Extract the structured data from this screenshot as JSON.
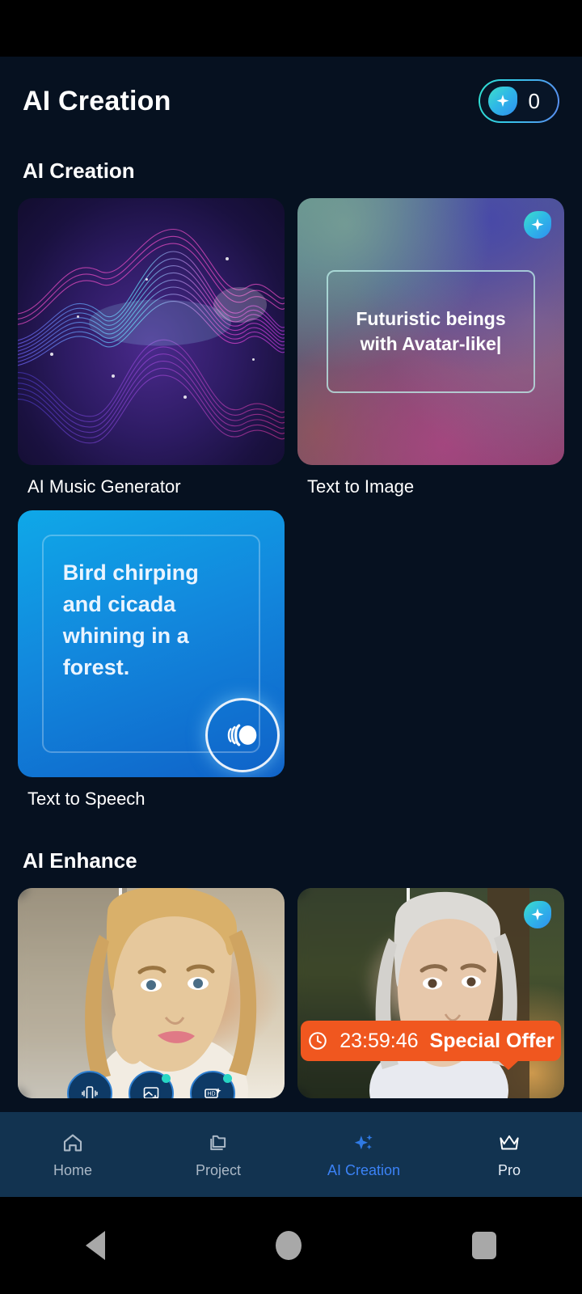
{
  "header": {
    "title": "AI Creation",
    "credits_value": "0",
    "credits_icon": "sparkle-droplet-icon"
  },
  "sections": [
    {
      "title": "AI Creation"
    },
    {
      "title": "AI Enhance"
    }
  ],
  "creation_cards": [
    {
      "label": "AI Music Generator",
      "art": "sound-wave-art"
    },
    {
      "label": "Text to Image",
      "prompt": "Futuristic beings with Avatar-like|",
      "badge": "sparkle-droplet-icon"
    },
    {
      "label": "Text to Speech",
      "prompt": "Bird chirping and cicada whining in a forest.",
      "icon": "speaker-icon"
    }
  ],
  "enhance_cards": [
    {
      "art": "portrait-before-after-indoor",
      "actions": [
        {
          "icon": "stabilize-icon",
          "has_badge": false
        },
        {
          "icon": "image-enhance-icon",
          "has_badge": true
        },
        {
          "icon": "hd-upscale-icon",
          "has_badge": true
        }
      ]
    },
    {
      "art": "portrait-before-after-outdoor",
      "badge": "sparkle-droplet-icon",
      "offer": {
        "clock_icon": "clock-icon",
        "time": "23:59:46",
        "label": "Special Offer"
      }
    }
  ],
  "tabs": [
    {
      "label": "Home",
      "icon": "home-icon",
      "active": false
    },
    {
      "label": "Project",
      "icon": "folder-icon",
      "active": false
    },
    {
      "label": "AI Creation",
      "icon": "sparkle-icon",
      "active": true
    },
    {
      "label": "Pro",
      "icon": "crown-icon",
      "active": false
    }
  ],
  "system_nav": [
    {
      "name": "back-button"
    },
    {
      "name": "home-button"
    },
    {
      "name": "recents-button"
    }
  ],
  "colors": {
    "background": "#061120",
    "accent": "#3b82f6",
    "tabbar": "#123350",
    "offer": "#f0571f",
    "badge_gradient_start": "#3ee0c8",
    "badge_gradient_end": "#2f8ef0"
  }
}
